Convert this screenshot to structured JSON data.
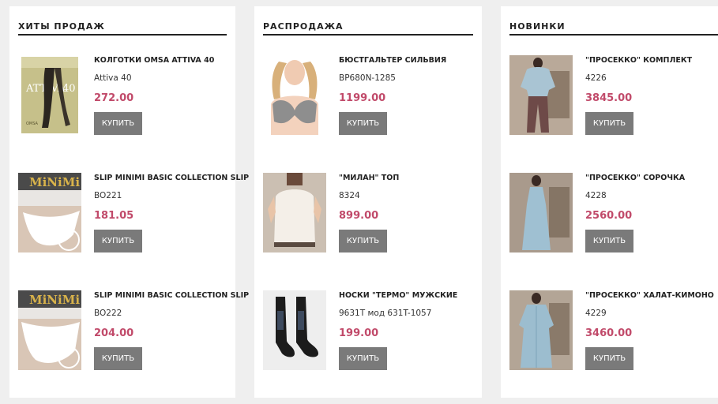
{
  "columns": [
    {
      "title": "ХИТЫ ПРОДАЖ",
      "products": [
        {
          "name": "КОЛГОТКИ OMSA ATTIVA 40",
          "sku": "Attiva 40",
          "price": "272.00",
          "buy": "КУПИТЬ",
          "image": "tights-package-photo"
        },
        {
          "name": "SLIP MINIMI BASIC COLLECTION SLIP",
          "sku": "BO221",
          "price": "181.05",
          "buy": "КУПИТЬ",
          "image": "white-briefs-photo",
          "brand": "MiNiMi"
        },
        {
          "name": "SLIP MINIMI BASIC COLLECTION SLIP",
          "sku": "BO222",
          "price": "204.00",
          "buy": "КУПИТЬ",
          "image": "white-briefs-photo",
          "brand": "MiNiMi"
        }
      ]
    },
    {
      "title": "РАСПРОДАЖА",
      "products": [
        {
          "name": "БЮСТГАЛЬТЕР СИЛЬВИЯ",
          "sku": "BP680N-1285",
          "price": "1199.00",
          "buy": "КУПИТЬ",
          "image": "bra-model-photo"
        },
        {
          "name": "\"МИЛАН\" ТОП",
          "sku": "8324",
          "price": "899.00",
          "buy": "КУПИТЬ",
          "image": "silk-top-photo"
        },
        {
          "name": "НОСКИ \"ТЕРМО\" МУЖСКИЕ",
          "sku": "9631T мод 631T-1057",
          "price": "199.00",
          "buy": "КУПИТЬ",
          "image": "thermal-socks-photo"
        }
      ]
    },
    {
      "title": "НОВИНКИ",
      "products": [
        {
          "name": "\"ПРОСЕККО\" КОМПЛЕКТ",
          "sku": "4226",
          "price": "3845.00",
          "buy": "КУПИТЬ",
          "image": "pajama-set-photo"
        },
        {
          "name": "\"ПРОСЕККО\" СОРОЧКА",
          "sku": "4228",
          "price": "2560.00",
          "buy": "КУПИТЬ",
          "image": "nightgown-photo"
        },
        {
          "name": "\"ПРОСЕККО\" ХАЛАТ-КИМОНО",
          "sku": "4229",
          "price": "3460.00",
          "buy": "КУПИТЬ",
          "image": "kimono-robe-photo"
        }
      ]
    }
  ],
  "colors": {
    "price": "#c14a6a",
    "button": "#7a7a7a",
    "background": "#efefef"
  }
}
